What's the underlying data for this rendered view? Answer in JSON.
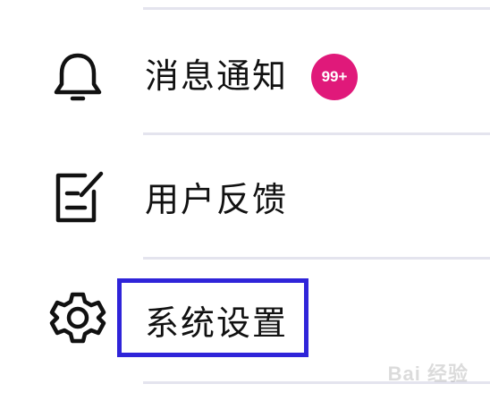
{
  "menu": {
    "items": [
      {
        "label": "消息通知",
        "icon": "bell-icon",
        "badge": "99+"
      },
      {
        "label": "用户反馈",
        "icon": "feedback-edit-icon"
      },
      {
        "label": "系统设置",
        "icon": "gear-icon",
        "highlighted": true
      }
    ]
  },
  "colors": {
    "badge": "#e0197a",
    "highlight_border": "#2f24d9",
    "divider": "#e4e4ee"
  },
  "watermark": {
    "text": "Bai 经验",
    "logo": "baidu-paw-logo"
  }
}
